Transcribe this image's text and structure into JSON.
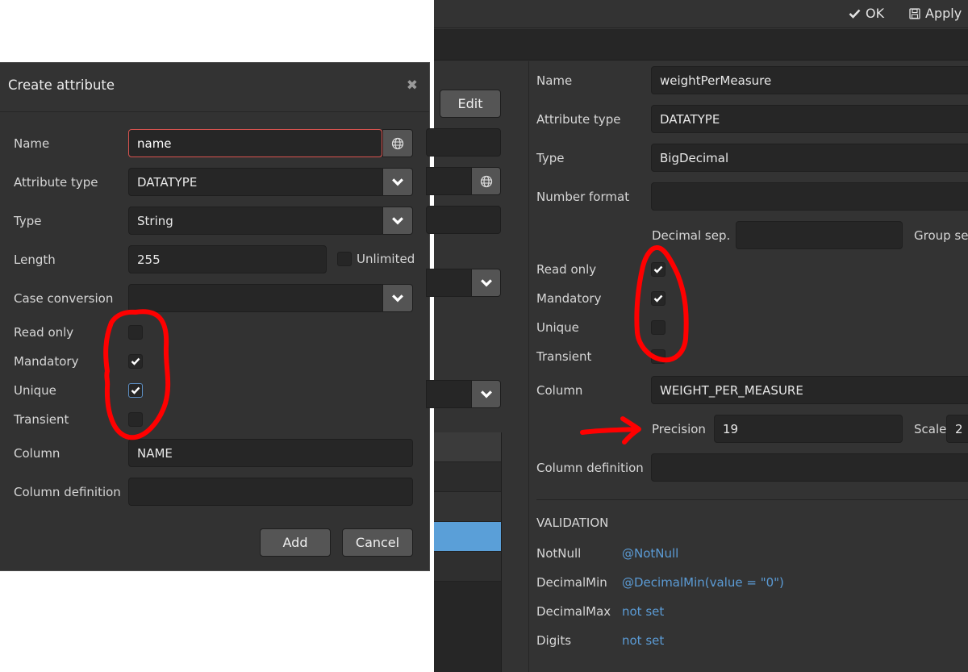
{
  "dialog": {
    "title": "Create attribute",
    "close_icon": "close-icon",
    "fields": {
      "name": {
        "label": "Name",
        "value": "name"
      },
      "attribute_type": {
        "label": "Attribute type",
        "value": "DATATYPE"
      },
      "type": {
        "label": "Type",
        "value": "String"
      },
      "length": {
        "label": "Length",
        "value": "255",
        "unlimited_label": "Unlimited",
        "unlimited_checked": false
      },
      "case_conversion": {
        "label": "Case conversion",
        "value": ""
      },
      "read_only": {
        "label": "Read only",
        "checked": false
      },
      "mandatory": {
        "label": "Mandatory",
        "checked": true
      },
      "unique": {
        "label": "Unique",
        "checked": true
      },
      "transient": {
        "label": "Transient",
        "checked": false
      },
      "column": {
        "label": "Column",
        "value": "NAME"
      },
      "column_definition": {
        "label": "Column definition",
        "value": ""
      }
    },
    "buttons": {
      "add": "Add",
      "cancel": "Cancel"
    }
  },
  "screen": {
    "toolbar": {
      "ok": "OK",
      "apply": "Apply"
    },
    "left": {
      "edit_button": "Edit"
    },
    "fields": {
      "name": {
        "label": "Name",
        "value": "weightPerMeasure"
      },
      "attribute_type": {
        "label": "Attribute type",
        "value": "DATATYPE"
      },
      "type": {
        "label": "Type",
        "value": "BigDecimal"
      },
      "number_format": {
        "label": "Number format",
        "value": ""
      },
      "decimal_sep": {
        "label": "Decimal sep.",
        "value": ""
      },
      "group_sep": {
        "label": "Group se"
      },
      "read_only": {
        "label": "Read only",
        "checked": true
      },
      "mandatory": {
        "label": "Mandatory",
        "checked": true
      },
      "unique": {
        "label": "Unique",
        "checked": false
      },
      "transient": {
        "label": "Transient",
        "checked": false
      },
      "column": {
        "label": "Column",
        "value": "WEIGHT_PER_MEASURE"
      },
      "precision": {
        "label": "Precision",
        "value": "19"
      },
      "scale": {
        "label": "Scale",
        "value": "2"
      },
      "column_definition": {
        "label": "Column definition",
        "value": ""
      }
    },
    "validation": {
      "heading": "VALIDATION",
      "rows": [
        {
          "label": "NotNull",
          "value": "@NotNull"
        },
        {
          "label": "DecimalMin",
          "value": "@DecimalMin(value = \"0\")"
        },
        {
          "label": "DecimalMax",
          "value": "not set"
        },
        {
          "label": "Digits",
          "value": "not set"
        }
      ]
    }
  },
  "colors": {
    "panel": "#333333",
    "input": "#262626",
    "link": "#5b9bd5",
    "selected_row": "#5a9fd8",
    "error_border": "#d9534f",
    "annotation": "#ff0000"
  }
}
